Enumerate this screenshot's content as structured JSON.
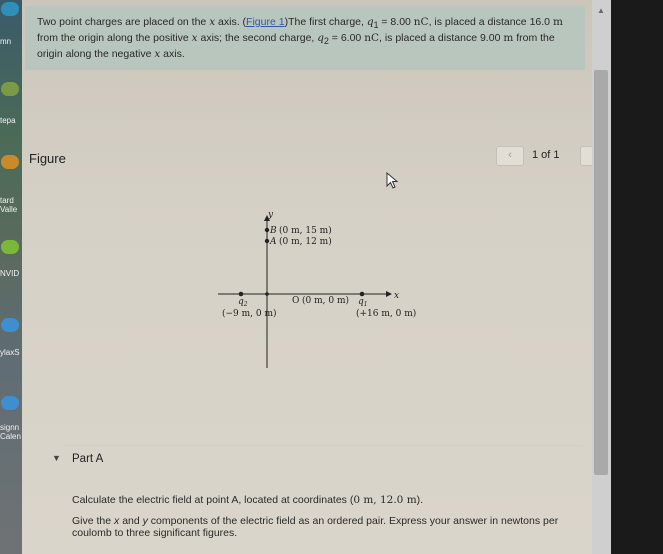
{
  "sidebar": {
    "items": [
      "mn",
      "tepa",
      "tard",
      "Valle",
      "NVID",
      "ylaxS",
      "signn",
      "Calen"
    ]
  },
  "problem": {
    "text1": "Two point charges are placed on the ",
    "x_var": "x",
    "text2": " axis. (",
    "figure_link": "Figure 1",
    "text3": ")The first charge, ",
    "q1_sym": "q",
    "q1_sub": "1",
    "q1_value": " = 8.00 ",
    "q1_unit": "nC",
    "text4": ", is placed a distance ",
    "d1_value": "16.0 ",
    "d1_unit": "m",
    "text5": "from the origin along the positive ",
    "x_var2": "x",
    "text6": " axis; the second charge, ",
    "q2_sym": "q",
    "q2_sub": "2",
    "q2_value": " = 6.00 ",
    "q2_unit": "nC",
    "text7": ", is placed a distance ",
    "d2_value": "9.00 ",
    "d2_unit": "m",
    "text8": " from the",
    "text9": "origin along the negative ",
    "x_var3": "x",
    "text10": " axis."
  },
  "figure": {
    "heading": "Figure",
    "pager_text": "1 of 1",
    "prev_glyph": "‹",
    "next_glyph": "›"
  },
  "diagram": {
    "y_axis": "y",
    "x_axis": "x",
    "point_b_name": "B",
    "point_b_coords": "(0 m, 15 m)",
    "point_a_name": "A",
    "point_a_coords": "(0 m, 12 m)",
    "origin_name": "O",
    "origin_coords": "(0 m, 0 m)",
    "q2_name": "q",
    "q2_sub": "2",
    "q2_coords": "(−9 m, 0 m)",
    "q1_name": "q",
    "q1_sub": "1",
    "q1_coords": "(+16 m, 0 m)"
  },
  "part_a": {
    "toggle": "▼",
    "title": "Part A",
    "q_text1": "Calculate the electric field at point A, located at coordinates (",
    "q_coords": "0 m, 12.0 m",
    "q_text2": ").",
    "instr_text1": "Give the ",
    "instr_x": "x",
    "instr_text2": " and ",
    "instr_y": "y",
    "instr_text3": " components of the electric field as an ordered pair. Express your answer in newtons per coulomb to three significant figures."
  },
  "colors": {
    "problem_bg": "#b9c6bd",
    "link": "#2f5aa8"
  }
}
